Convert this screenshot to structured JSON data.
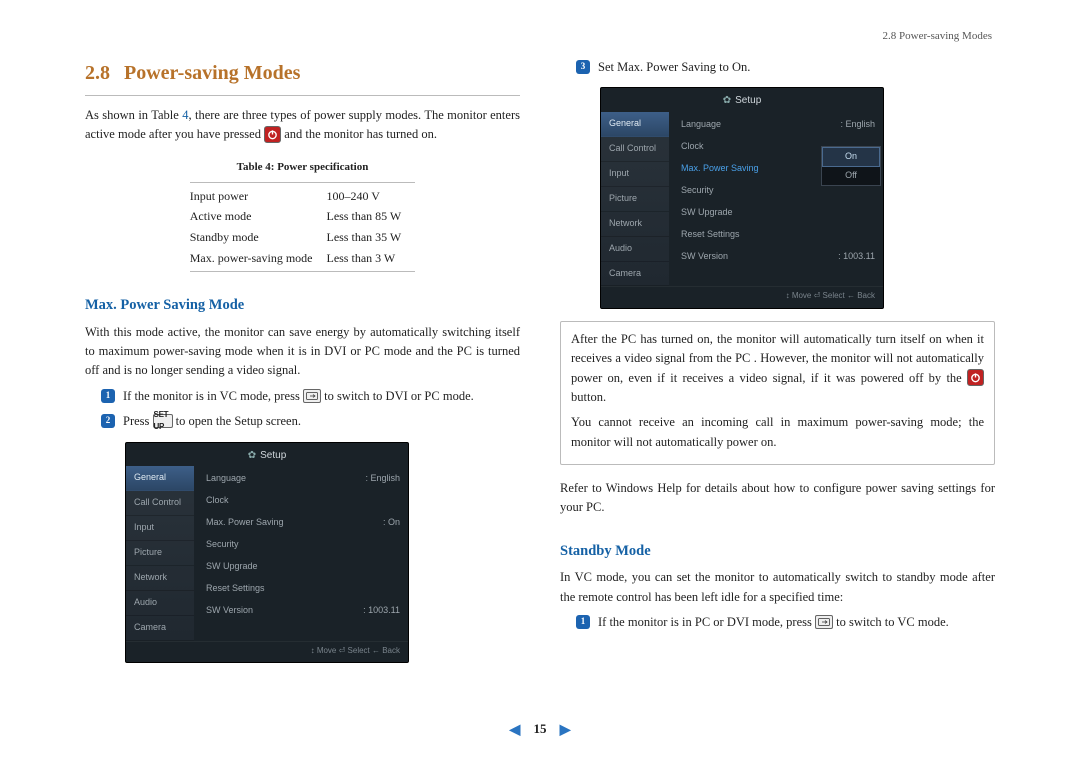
{
  "running_head": "2.8 Power-saving Modes",
  "section": {
    "number": "2.8",
    "title": "Power-saving Modes"
  },
  "intro_a": "As shown in Table ",
  "table_ref": "4",
  "intro_b": ", there are three types of power supply modes. The monitor enters active mode after you have pressed ",
  "intro_c": " and the monitor has turned on.",
  "table_caption": "Table 4: Power specification",
  "spec_table": [
    {
      "k": "Input power",
      "v": "100–240 V"
    },
    {
      "k": "Active mode",
      "v": "Less than 85 W"
    },
    {
      "k": "Standby mode",
      "v": "Less than 35 W"
    },
    {
      "k": "Max. power-saving mode",
      "v": "Less than 3 W"
    }
  ],
  "sub_max": "Max. Power Saving Mode",
  "max_para": "With this mode active, the monitor can save energy by automatically switching itself to maximum power-saving mode when it is in DVI or PC mode and the PC is turned off and is no longer sending a video signal.",
  "steps_left": [
    {
      "n": "1",
      "pre": "If the monitor is in VC mode, press ",
      "icon": "source",
      "post": " to switch to DVI or PC mode."
    },
    {
      "n": "2",
      "pre": "Press ",
      "icon": "setup",
      "post": " to open the Setup screen.",
      "label": "SET UP"
    }
  ],
  "osd1": {
    "title": "Setup",
    "side": [
      "General",
      "Call Control",
      "Input",
      "Picture",
      "Network",
      "Audio",
      "Camera"
    ],
    "side_selected": 0,
    "rows": [
      {
        "k": "Language",
        "v": ": English"
      },
      {
        "k": "Clock",
        "v": ""
      },
      {
        "k": "Max. Power Saving",
        "v": ": On"
      },
      {
        "k": "Security",
        "v": ""
      },
      {
        "k": "SW Upgrade",
        "v": ""
      },
      {
        "k": "Reset Settings",
        "v": ""
      },
      {
        "k": "SW Version",
        "v": ": 1003.11"
      }
    ],
    "foot": "↕ Move    ⏎ Select    ← Back"
  },
  "step3": {
    "n": "3",
    "text": "Set Max. Power Saving to On."
  },
  "osd2": {
    "title": "Setup",
    "side": [
      "General",
      "Call Control",
      "Input",
      "Picture",
      "Network",
      "Audio",
      "Camera"
    ],
    "side_selected": 0,
    "rows": [
      {
        "k": "Language",
        "v": ": English"
      },
      {
        "k": "Clock",
        "v": ""
      },
      {
        "k": "Max. Power Saving",
        "v": "",
        "hl": true
      },
      {
        "k": "Security",
        "v": ""
      },
      {
        "k": "SW Upgrade",
        "v": ""
      },
      {
        "k": "Reset Settings",
        "v": ""
      },
      {
        "k": "SW Version",
        "v": ": 1003.11"
      }
    ],
    "popup": [
      "On",
      "Off"
    ],
    "foot": "↕ Move    ⏎ Select    ← Back"
  },
  "note": {
    "p1a": "After the PC has turned on, the monitor will automatically turn itself on when it receives a video signal from the PC . However, the monitor will not automatically power on, even if it receives a video signal, if it was powered off by the ",
    "p1b": " button.",
    "p2": "You cannot receive an incoming call in maximum power-saving mode; the monitor will not automatically power on."
  },
  "refer_pc": "Refer to Windows Help for details about how to configure power saving settings for your PC.",
  "sub_standby": "Standby Mode",
  "standby_para": "In VC mode, you can set the monitor to automatically switch to standby mode after the remote control has been left idle for a specified time:",
  "step_standby": {
    "n": "1",
    "pre": "If the monitor is in PC or DVI mode, press ",
    "post": " to switch to VC mode."
  },
  "page_number": "15",
  "icons": {
    "power": "power-icon",
    "source": "source-icon",
    "setup": "SET UP"
  }
}
